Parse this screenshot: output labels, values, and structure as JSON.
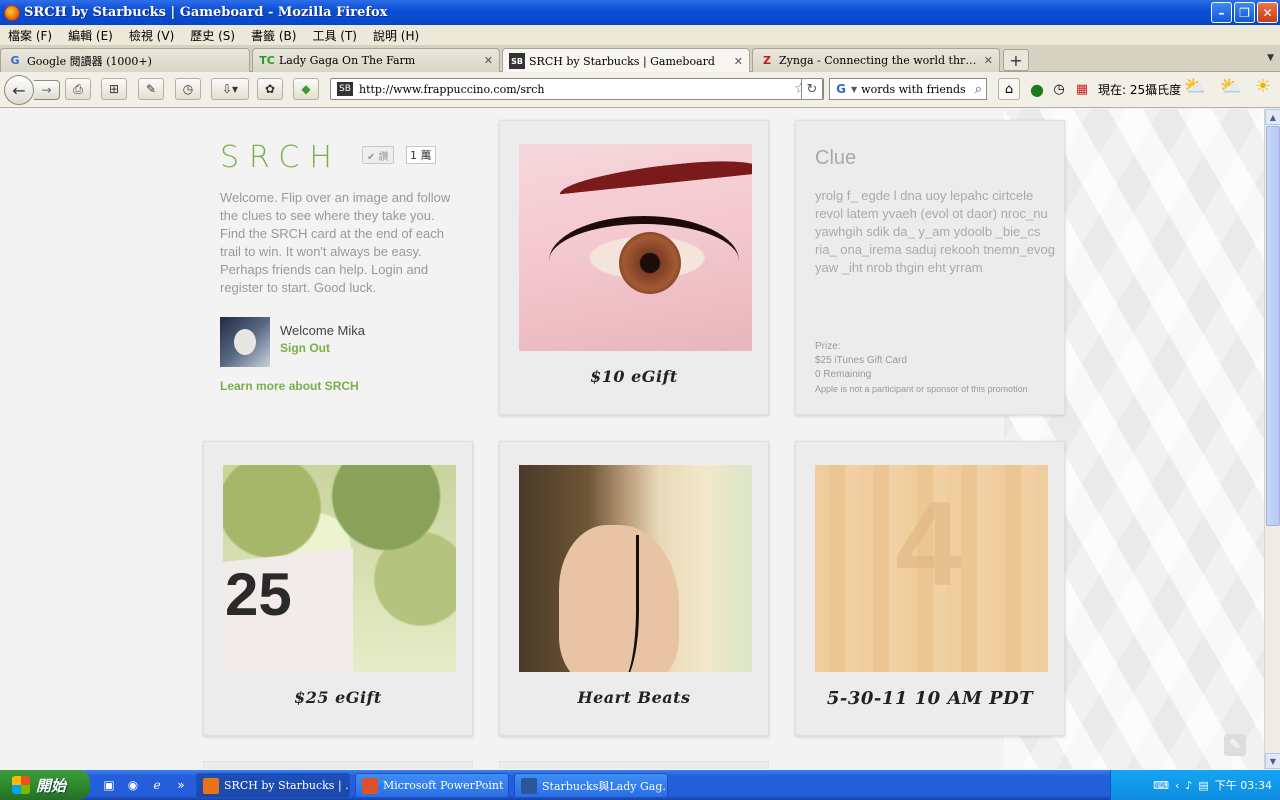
{
  "window": {
    "title": "SRCH by Starbucks | Gameboard - Mozilla Firefox"
  },
  "menu": [
    "檔案 (F)",
    "編輯 (E)",
    "檢視 (V)",
    "歷史 (S)",
    "書籤 (B)",
    "工具 (T)",
    "說明 (H)"
  ],
  "tabs": [
    {
      "label": "Google 閱讀器 (1000+)",
      "icon": "G"
    },
    {
      "label": "Lady Gaga On The Farm",
      "icon": "TC"
    },
    {
      "label": "SRCH by Starbucks | Gameboard",
      "icon": "SB"
    },
    {
      "label": "Zynga - Connecting the world through ga…",
      "icon": "Z"
    }
  ],
  "navbar": {
    "url": "http://www.frappuccino.com/srch",
    "search_value": "words with friends",
    "weather": "現在: 25攝氏度"
  },
  "page": {
    "logo": "SRCH",
    "like_label": "✔ 讚",
    "like_count": "1 萬",
    "intro": "Welcome. Flip over an image and follow the clues to see where they take you. Find the SRCH card at the end of each trail to win. It won't always be easy. Perhaps friends can help. Login and register to start. Good luck.",
    "welcome": "Welcome Mika",
    "sign_out": "Sign Out",
    "learn_more": "Learn more about SRCH",
    "cards": [
      {
        "caption": "$10 eGift"
      },
      {
        "caption": "$25 eGift"
      },
      {
        "caption": "Heart Beats"
      },
      {
        "caption": "5-30-11   10 AM PDT"
      }
    ],
    "clue": {
      "title": "Clue",
      "text": "yrolg f_ egde l dna uoy lepahc cirtcele revol latem yvaeh (evol ot daor) nroc_nu yawhgih sdik da_ y_am ydoolb _bie_cs ria_ ona_irema saduj rekooh tnemn_evog yaw _iht nrob thgin eht yrram",
      "prize_label": "Prize:",
      "prize": "$25 iTunes Gift Card",
      "remaining": "0 Remaining",
      "disclaimer": "Apple is not a participant or sponsor of this promotion"
    },
    "sign_number": "25"
  },
  "taskbar": {
    "start": "開始",
    "tasks": [
      {
        "label": "SRCH by Starbucks | ...",
        "icon_color": "#e8731a"
      },
      {
        "label": "Microsoft PowerPoint ...",
        "icon_color": "#d9542b"
      },
      {
        "label": "Starbucks與Lady Gag...",
        "icon_color": "#2b579a"
      }
    ],
    "clock": "下午 03:34"
  }
}
